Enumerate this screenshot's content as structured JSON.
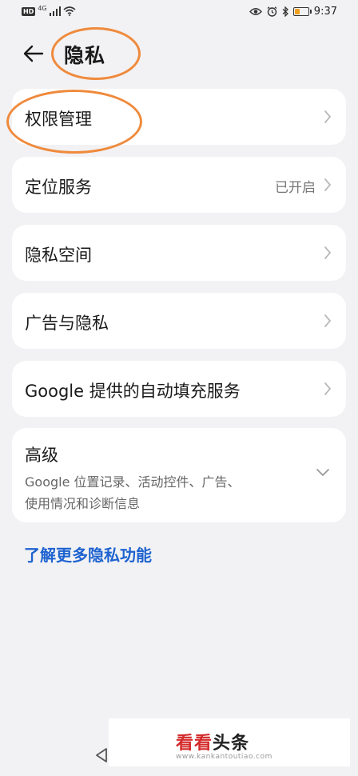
{
  "status_bar": {
    "hd_badge": "HD",
    "net_badge": "4G",
    "time": "9:37",
    "battery_level": 0.35,
    "battery_color": "#f0a020",
    "icons": [
      "signal-icon",
      "wifi-icon",
      "eye-icon",
      "alarm-icon",
      "bluetooth-icon",
      "battery-icon"
    ]
  },
  "header": {
    "title": "隐私",
    "back_icon": "arrow-left-icon"
  },
  "menu": {
    "permission": {
      "label": "权限管理"
    },
    "location": {
      "label": "定位服务",
      "value": "已开启"
    },
    "private_space": {
      "label": "隐私空间"
    },
    "ads": {
      "label": "广告与隐私"
    },
    "autofill": {
      "label": "Google 提供的自动填充服务"
    },
    "advanced": {
      "label": "高级",
      "line1": "Google 位置记录、活动控件、广告、",
      "line2": "使用情况和诊断信息"
    }
  },
  "link": {
    "text": "了解更多隐私功能"
  },
  "watermark": {
    "brand_a": "看看",
    "brand_b": "头条",
    "url": "www.kankantoutiao.com"
  },
  "colors": {
    "accent": "#1e63d0",
    "annotation": "#ef8a3c",
    "background": "#f2f2f4"
  }
}
